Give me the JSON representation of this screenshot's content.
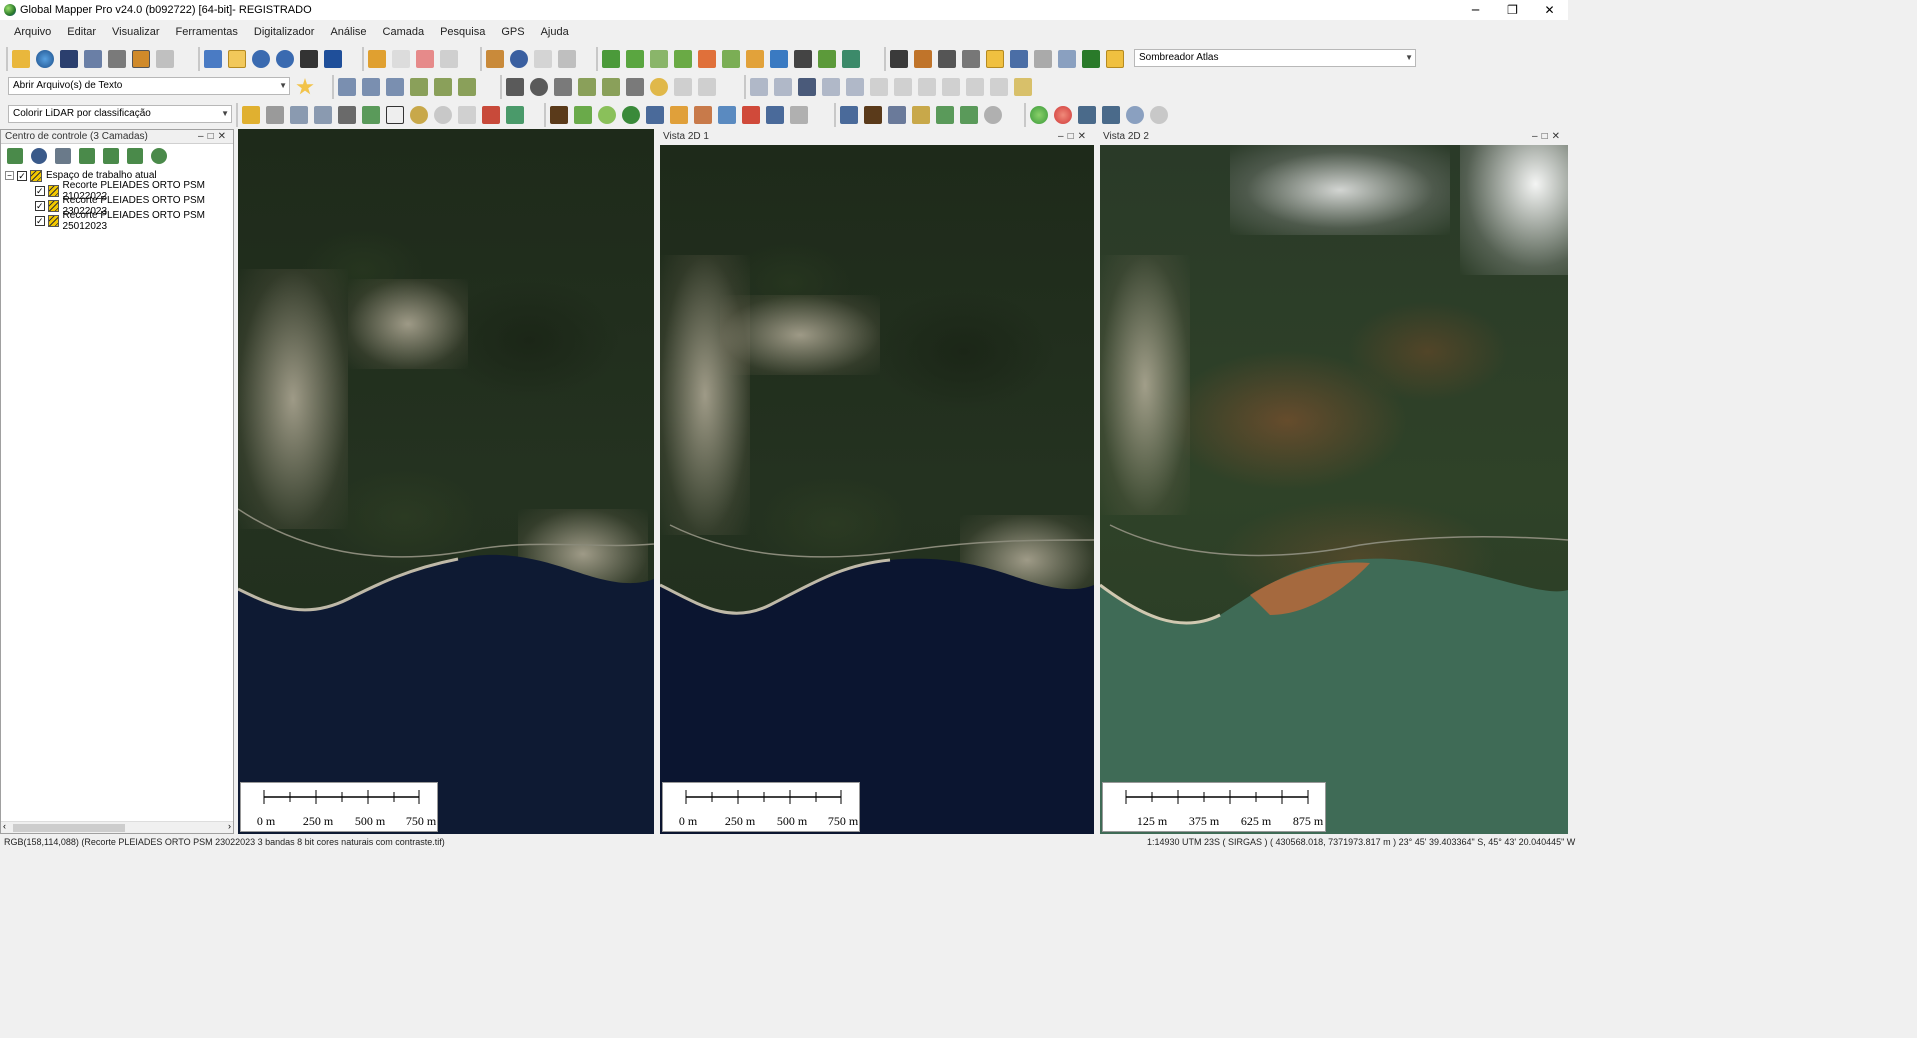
{
  "window": {
    "title": "Global Mapper Pro v24.0 (b092722) [64-bit]- REGISTRADO",
    "controls": [
      "─",
      "❐",
      "✕"
    ]
  },
  "menu": [
    "Arquivo",
    "Editar",
    "Visualizar",
    "Ferramentas",
    "Digitalizador",
    "Análise",
    "Camada",
    "Pesquisa",
    "GPS",
    "Ajuda"
  ],
  "toolbars": {
    "shader_select": "Sombreador Atlas",
    "text_file_select": "Abrir Arquivo(s) de Texto",
    "lidar_select": "Colorir LiDAR por classificação"
  },
  "control_center": {
    "title": "Centro de controle (3 Camadas)",
    "workspace": "Espaço de trabalho atual",
    "layers": [
      "Recorte PLEIADES ORTO PSM 21022022",
      "Recorte PLEIADES ORTO PSM 23022023",
      "Recorte PLEIADES ORTO PSM 25012023"
    ]
  },
  "views": [
    {
      "title": "",
      "scale_labels": [
        "0 m",
        "250 m",
        "500 m",
        "750 m"
      ]
    },
    {
      "title": "Vista 2D 1",
      "scale_labels": [
        "0 m",
        "250 m",
        "500 m",
        "750 m"
      ]
    },
    {
      "title": "Vista 2D 2",
      "scale_labels": [
        "125 m",
        "375 m",
        "625 m",
        "875 m"
      ]
    }
  ],
  "status": {
    "left": "RGB(158,114,088) (Recorte PLEIADES ORTO PSM 23022023 3 bandas 8 bit cores naturais com contraste.tif)",
    "right": "1:14930   UTM 23S ( SIRGAS ) ( 430568.018, 7371973.817 m )   23° 45' 39.403364\" S, 45° 43' 20.040445\" W"
  },
  "colors": {
    "forest": "#1f2c1b",
    "sea_dark": "#0e1a33",
    "sea_green": "#3f6b56",
    "mud": "#b7683a"
  }
}
